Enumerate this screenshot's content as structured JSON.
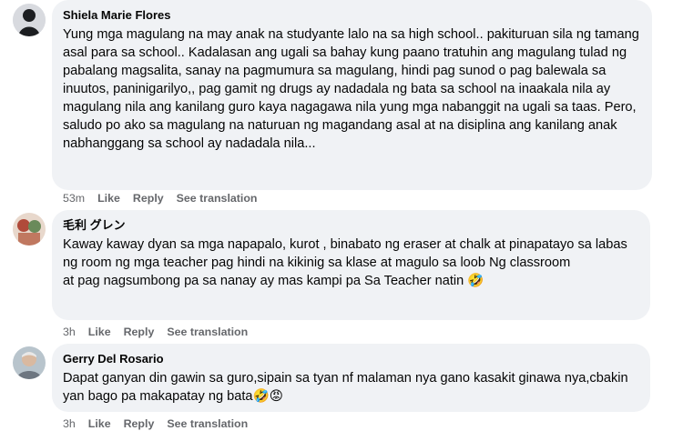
{
  "comments": [
    {
      "author": "Shiela Marie Flores",
      "text": "Yung mga magulang na may anak na studyante lalo na sa high school.. pakituruan sila ng tamang asal para sa school.. Kadalasan ang ugali sa bahay kung paano tratuhin ang magulang tulad ng pabalang magsalita, sanay na pagmumura sa magulang, hindi pag sunod o pag balewala sa inuutos, paninigarilyo,, pag gamit ng drugs ay nadadala ng bata sa school na inaakala nila ay magulang nila ang kanilang guro kaya nagagawa nila yung mga nabanggit na ugali sa taas. Pero, saludo po ako sa magulang na naturuan ng magandang asal at na disiplina ang kanilang anak nabhanggang sa school ay nadadala nila...",
      "time": "53m",
      "like": "Like",
      "reply": "Reply",
      "translate": "See translation",
      "avatar_color": "#1c1e21"
    },
    {
      "author": "毛利 グレン",
      "text": "Kaway kaway dyan sa mga napapalo, kurot , binabato ng eraser at chalk at pinapatayo sa labas ng room ng mga teacher pag hindi na kikinig sa klase at magulo sa loob Ng classroom\nat pag nagsumbong pa sa nanay ay mas kampi pa Sa Teacher natin 🤣",
      "time": "3h",
      "like": "Like",
      "reply": "Reply",
      "translate": "See translation",
      "avatar_color": "#c9a08a"
    },
    {
      "author": "Gerry Del Rosario",
      "text": "Dapat ganyan din gawin sa guro,sipain sa tyan nf malaman nya gano kasakit ginawa nya,cbakin yan bago pa makapatay ng bata🤣😡",
      "time": "3h",
      "like": "Like",
      "reply": "Reply",
      "translate": "See translation",
      "avatar_color": "#8a8f95"
    }
  ]
}
